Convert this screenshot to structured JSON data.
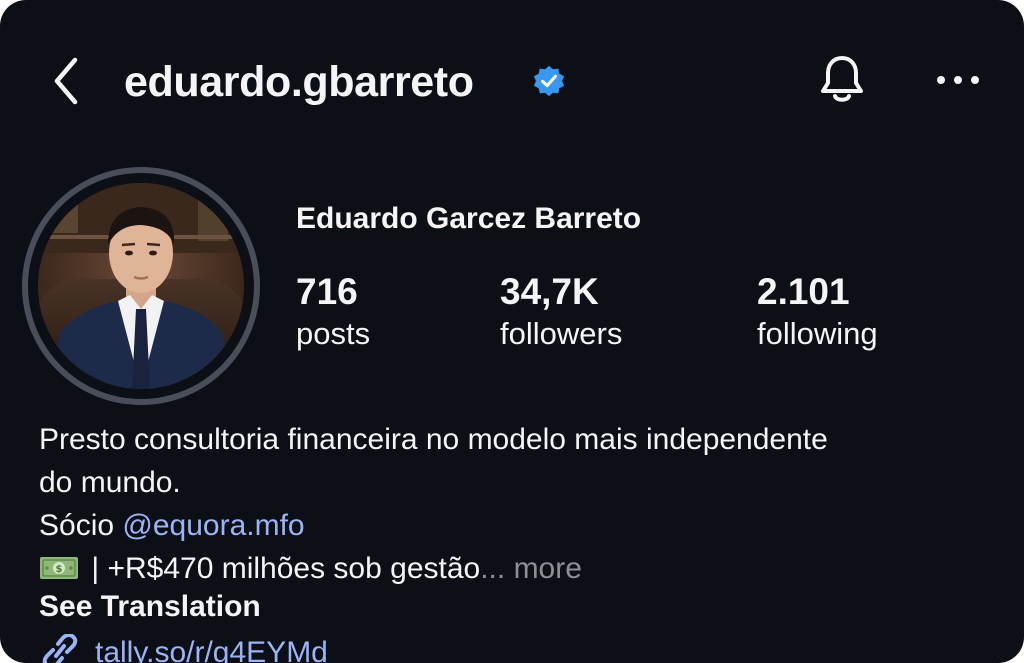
{
  "header": {
    "username": "eduardo.gbarreto",
    "verified": true
  },
  "profile": {
    "full_name": "Eduardo Garcez Barreto",
    "stats": {
      "posts": {
        "value": "716",
        "label": "posts"
      },
      "followers": {
        "value": "34,7K",
        "label": "followers"
      },
      "following": {
        "value": "2.101",
        "label": "following"
      }
    }
  },
  "bio": {
    "line1": "Presto consultoria financeira no modelo mais independente",
    "line2": "do mundo.",
    "partner_prefix": "Sócio ",
    "partner_mention": "@equora.mfo",
    "aum_text": " | +R$470 milhões sob gestão",
    "ellipsis": "...",
    "more_label": " more",
    "see_translation": "See Translation",
    "link": "tally.so/r/g4EYMd"
  },
  "icons": {
    "back": "chevron-left-icon",
    "verified": "verified-badge-icon",
    "notifications": "bell-icon",
    "more": "ellipsis-icon",
    "money": "money-bill-emoji-icon",
    "link": "link-chain-icon"
  },
  "colors": {
    "background": "#0d0f17",
    "text": "#f5f5f7",
    "link": "#9ab4f6",
    "muted": "#8e8e93",
    "verified": "#3897f0",
    "avatar_ring": "#4a4e59"
  }
}
